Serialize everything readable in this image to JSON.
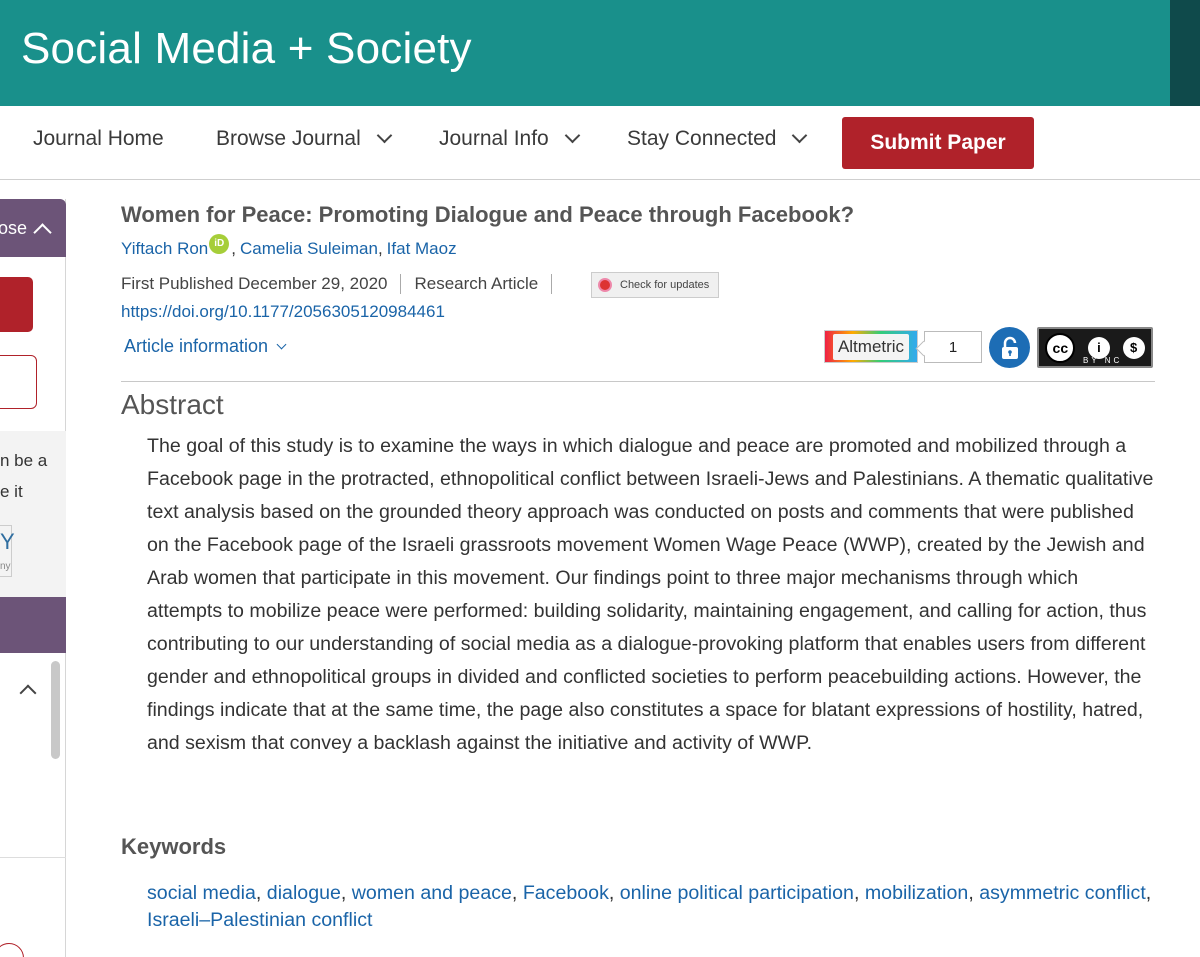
{
  "banner": {
    "title": "Social Media + Society"
  },
  "nav": {
    "items": [
      {
        "label": "Journal Home"
      },
      {
        "label": "Browse Journal"
      },
      {
        "label": "Journal Info"
      },
      {
        "label": "Stay Connected"
      }
    ],
    "submit_label": "Submit Paper"
  },
  "sidebar": {
    "close_label": "ose",
    "text_line1": "n be a",
    "text_line2": "e it",
    "letter": "Y",
    "small": "ny"
  },
  "article": {
    "title": "Women for Peace: Promoting Dialogue and Peace through Facebook?",
    "authors": [
      "Yiftach Ron",
      "Camelia Suleiman",
      "Ifat Maoz"
    ],
    "orcid_label": "iD",
    "first_published": "First Published December 29, 2020",
    "type": "Research Article",
    "check_updates": "Check for updates",
    "doi": "https://doi.org/10.1177/2056305120984461",
    "article_info": "Article information",
    "altmetric_label": "Altmetric",
    "altmetric_count": "1",
    "cc_labels": "BY NC"
  },
  "abstract": {
    "heading": "Abstract",
    "text": "The goal of this study is to examine the ways in which dialogue and peace are promoted and mobilized through a Facebook page in the protracted, ethnopolitical conflict between Israeli-Jews and Palestinians. A thematic qualitative text analysis based on the grounded theory approach was conducted on posts and comments that were published on the Facebook page of the Israeli grassroots movement Women Wage Peace (WWP), created by the Jewish and Arab women that participate in this movement. Our findings point to three major mechanisms through which attempts to mobilize peace were performed: building solidarity, maintaining engagement, and calling for action, thus contributing to our understanding of social media as a dialogue-provoking platform that enables users from different gender and ethnopolitical groups in divided and conflicted societies to perform peacebuilding actions. However, the findings indicate that at the same time, the page also constitutes a space for blatant expressions of hostility, hatred, and sexism that convey a backlash against the initiative and activity of WWP."
  },
  "keywords": {
    "heading": "Keywords",
    "items": [
      "social media",
      "dialogue",
      "women and peace",
      "Facebook",
      "online political participation",
      "mobilization",
      "asymmetric conflict",
      "Israeli–Palestinian conflict"
    ]
  },
  "colors": {
    "banner": "#19908b",
    "accent_red": "#b0222a",
    "link": "#1a64a8",
    "sidebar_purple": "#6c5478"
  }
}
